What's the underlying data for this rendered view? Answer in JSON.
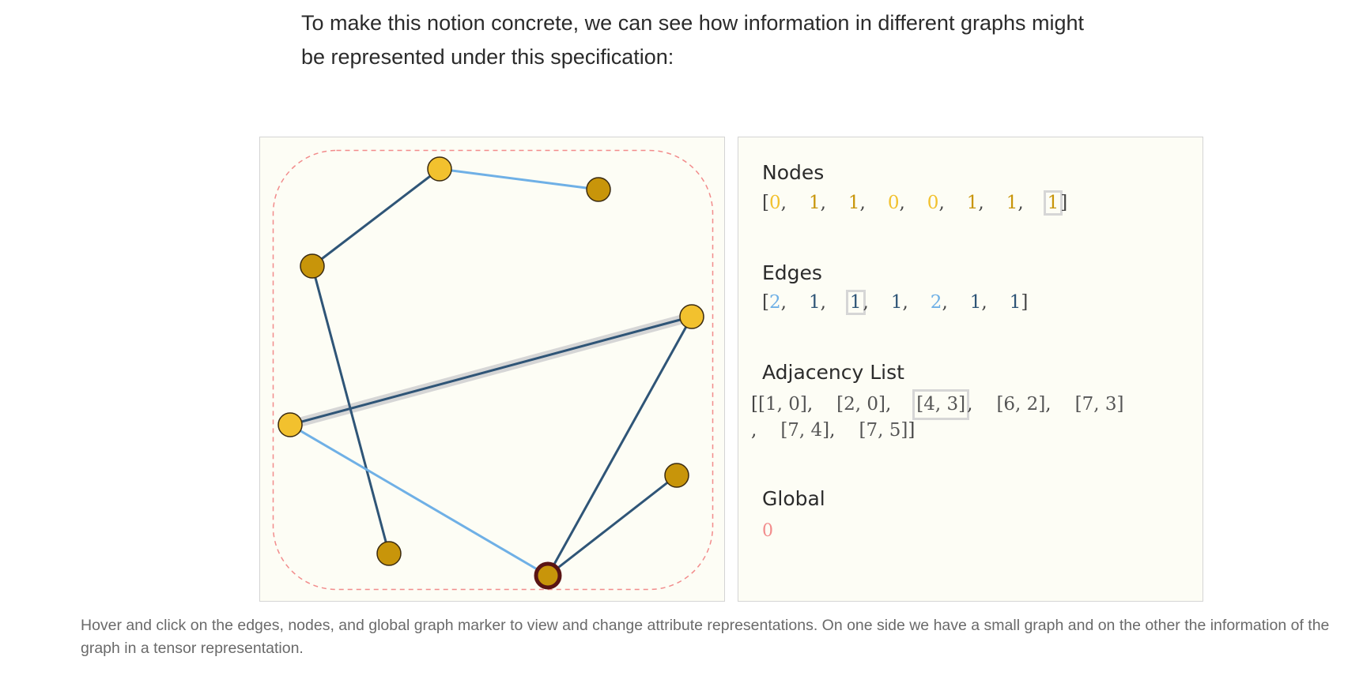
{
  "intro_text": "To make this notion concrete, we can see how information in different graphs might be represented under this specification:",
  "caption": "Hover and click on the edges, nodes, and global graph marker to view and change attribute representations. On one side we have a small graph and on the other the information of the graph in a tensor representation.",
  "colors": {
    "node_value_0": "#f2c12e",
    "node_value_1": "#c8950a",
    "edge_value_1": "#2f5577",
    "edge_value_2": "#6fb0e6",
    "global_value": "#f28c8c",
    "global_border": "#f28c8c",
    "selected_highlight": "#d6d6d6",
    "selected_node_ring": "#5a1414"
  },
  "sections": {
    "nodes_title": "Nodes",
    "edges_title": "Edges",
    "adjacency_title": "Adjacency List",
    "global_title": "Global"
  },
  "nodes": {
    "open": "[",
    "close": "]",
    "values": [
      "0",
      "1",
      "1",
      "0",
      "0",
      "1",
      "1",
      "1"
    ],
    "selected_index": 7
  },
  "edges": {
    "open": "[",
    "close": "]",
    "values": [
      "2",
      "1",
      "1",
      "1",
      "2",
      "1",
      "1"
    ],
    "selected_index": 2
  },
  "adjacency": {
    "open": "[",
    "close": "]",
    "pairs": [
      "[1, 0]",
      "[2, 0]",
      "[4, 3]",
      "[6, 2]",
      "[7, 3]",
      "[7, 4]",
      "[7, 5]"
    ],
    "selected_index": 2
  },
  "global": {
    "value": "0"
  }
}
